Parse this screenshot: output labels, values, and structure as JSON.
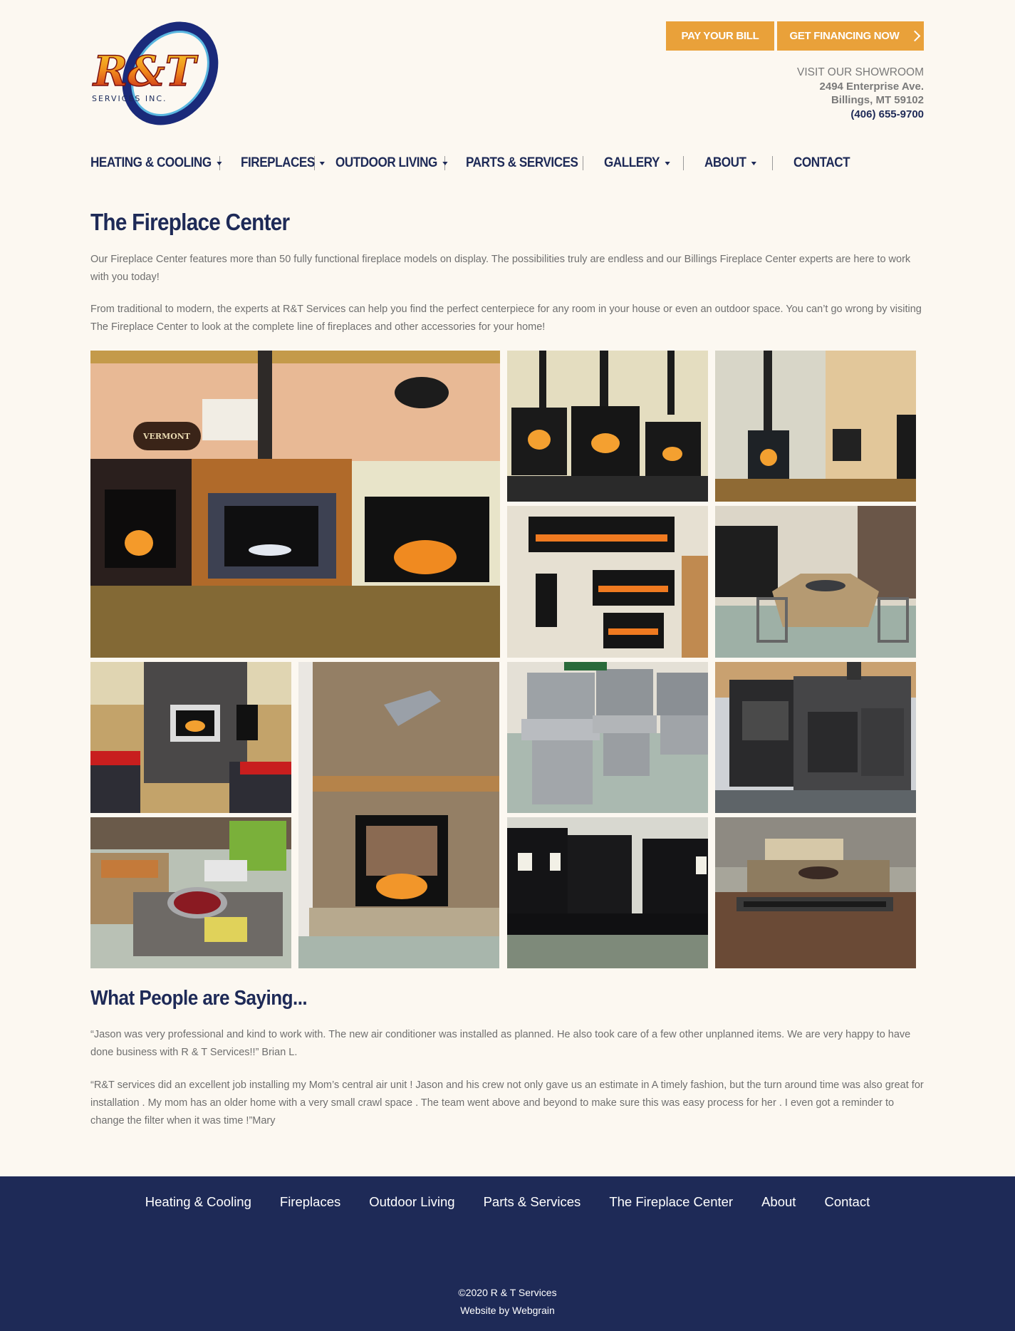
{
  "brand": {
    "logo_text": "R&T",
    "logo_subtext": "SERVICES INC."
  },
  "top_buttons": {
    "pay_label": "PAY YOUR BILL",
    "financing_label": "GET FINANCING NOW"
  },
  "showroom": {
    "visit": "VISIT OUR SHOWROOM",
    "street": "2494 Enterprise Ave.",
    "city": "Billings, MT 59102",
    "phone": "(406) 655-9700"
  },
  "nav": {
    "items": [
      {
        "label": "HEATING & COOLING",
        "dropdown": true
      },
      {
        "label": "FIREPLACES",
        "dropdown": true
      },
      {
        "label": "OUTDOOR LIVING",
        "dropdown": true
      },
      {
        "label": "PARTS & SERVICES",
        "dropdown": false
      },
      {
        "label": "GALLERY",
        "dropdown": true
      },
      {
        "label": "ABOUT",
        "dropdown": true
      },
      {
        "label": "CONTACT",
        "dropdown": false
      }
    ]
  },
  "main": {
    "title": "The Fireplace Center",
    "para1": "Our Fireplace Center features more than 50 fully functional fireplace models on display. The possibilities truly are endless and our Billings Fireplace Center experts are here to work with you today!",
    "para2": "From traditional to modern, the experts at R&T Services can help you find the perfect centerpiece for any room in your house or even an outdoor space. You can’t go wrong by visiting The Fireplace Center to look at the complete line of fireplaces and other accessories for your home!",
    "sign_text": "VERMONT"
  },
  "testimonials": {
    "title": "What People are Saying...",
    "items": [
      "“Jason was very professional and kind to work with. The new air conditioner was installed as planned. He also took care of a few other unplanned items. We are very happy to have done business with R & T Services!!” Brian L.",
      "“R&T services did an excellent job installing my Mom’s central air unit ! Jason and his crew not only gave us an estimate in A timely fashion, but the turn around time was also great for installation . My mom has an older home with a very small crawl space . The team went above and beyond to make sure this was easy process for her . I even got a reminder to change the filter when it was time !”Mary"
    ]
  },
  "footer": {
    "links": [
      "Heating & Cooling",
      "Fireplaces",
      "Outdoor Living",
      "Parts & Services",
      "The Fireplace Center",
      "About",
      "Contact"
    ],
    "copyright": "©2020 R & T Services",
    "credit": "Website by Webgrain"
  },
  "colors": {
    "navy": "#1e2a57",
    "orange": "#e9a13a",
    "background": "#fcf8f1"
  }
}
